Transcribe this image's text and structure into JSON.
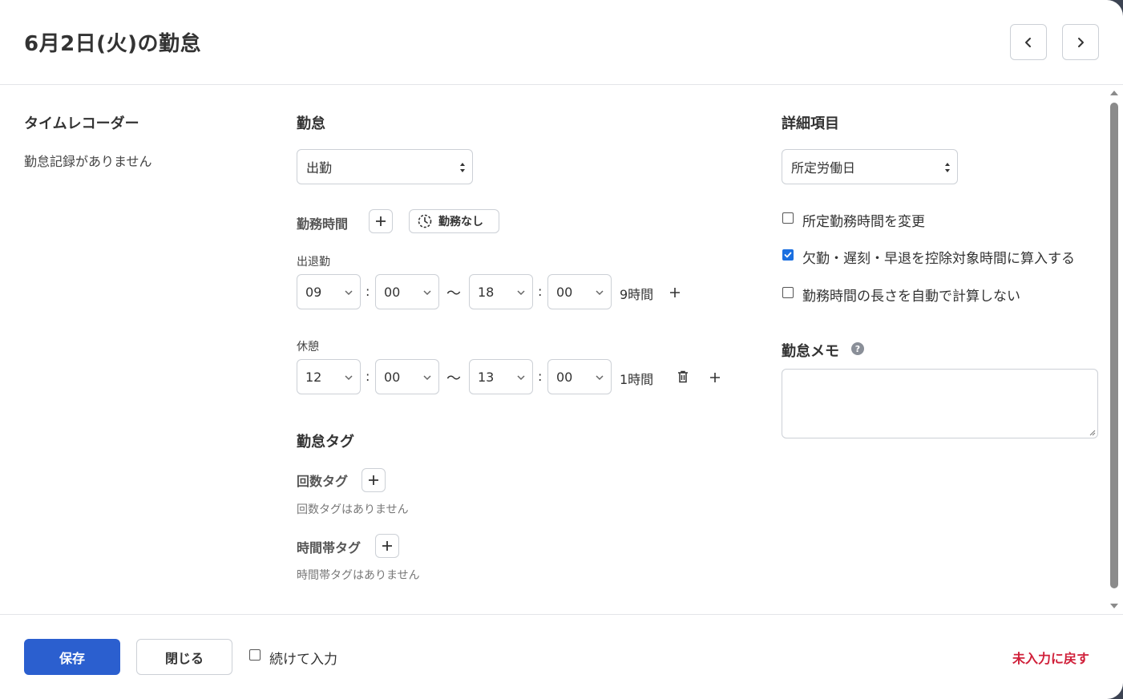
{
  "header": {
    "title": "6月2日(火)の勤怠",
    "prev_icon": "chevron-left-icon",
    "next_icon": "chevron-right-icon"
  },
  "time_recorder": {
    "heading": "タイムレコーダー",
    "empty_text": "勤怠記録がありません"
  },
  "attendance": {
    "heading": "勤怠",
    "type_value": "出勤",
    "work_time_label": "勤務時間",
    "no_work_label": "勤務なし",
    "shift_label": "出退勤",
    "shift": {
      "start_hour": "09",
      "start_min": "00",
      "end_hour": "18",
      "end_min": "00",
      "duration": "9時間"
    },
    "break_label": "休憩",
    "break": {
      "start_hour": "12",
      "start_min": "00",
      "end_hour": "13",
      "end_min": "00",
      "duration": "1時間"
    },
    "colon": ":",
    "tilde": "〜"
  },
  "tags": {
    "heading": "勤怠タグ",
    "count_tag_label": "回数タグ",
    "count_tag_empty": "回数タグはありません",
    "time_tag_label": "時間帯タグ",
    "time_tag_empty": "時間帯タグはありません"
  },
  "details": {
    "heading": "詳細項目",
    "day_type_value": "所定労働日",
    "options": [
      {
        "label": "所定勤務時間を変更",
        "checked": false
      },
      {
        "label": "欠勤・遅刻・早退を控除対象時間に算入する",
        "checked": true
      },
      {
        "label": "勤務時間の長さを自動で計算しない",
        "checked": false
      }
    ],
    "memo_heading": "勤怠メモ",
    "memo_value": ""
  },
  "footer": {
    "save_label": "保存",
    "close_label": "閉じる",
    "continue_label": "続けて入力",
    "continue_checked": false,
    "reset_label": "未入力に戻す"
  },
  "colors": {
    "primary": "#2b5fcf",
    "danger": "#d0203a",
    "checkbox": "#1a6fe0"
  }
}
